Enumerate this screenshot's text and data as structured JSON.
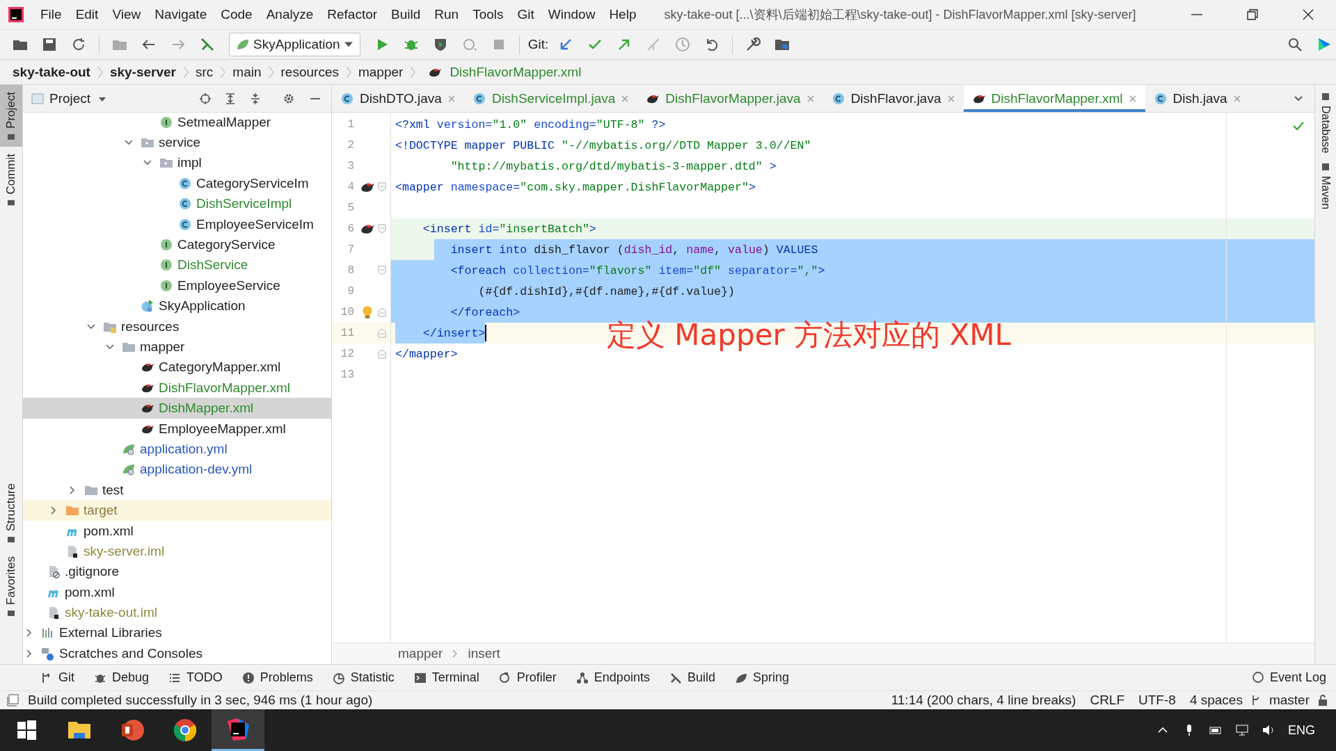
{
  "window": {
    "title": "sky-take-out [...\\资料\\后端初始工程\\sky-take-out] - DishFlavorMapper.xml [sky-server]"
  },
  "menu": [
    "File",
    "Edit",
    "View",
    "Navigate",
    "Code",
    "Analyze",
    "Refactor",
    "Build",
    "Run",
    "Tools",
    "Git",
    "Window",
    "Help"
  ],
  "toolbar": {
    "run_config": "SkyApplication",
    "git_label": "Git:"
  },
  "nav_path": [
    {
      "label": "sky-take-out",
      "kind": "module"
    },
    {
      "label": "sky-server",
      "kind": "module"
    },
    {
      "label": "src",
      "kind": "folder"
    },
    {
      "label": "main",
      "kind": "folder"
    },
    {
      "label": "resources",
      "kind": "folder"
    },
    {
      "label": "mapper",
      "kind": "folder"
    },
    {
      "label": "DishFlavorMapper.xml",
      "kind": "file"
    }
  ],
  "left_stripe": [
    {
      "label": "Project",
      "selected": true
    },
    {
      "label": "Commit",
      "selected": false
    },
    {
      "label": "Structure",
      "selected": false
    },
    {
      "label": "Favorites",
      "selected": false
    }
  ],
  "right_stripe": [
    {
      "label": "Database"
    },
    {
      "label": "Maven"
    }
  ],
  "project_panel": {
    "title": "Project",
    "tree": [
      {
        "children": [
          {
            "children": [
              {
                "children": [
                  {
                    "children": [
                      {
                        "children": [
                          {
                            "children": [
                              {
                                "children": [
                                  {
                                    "label": "SetmealMapper",
                                    "kind": "interface",
                                    "color": "#1f1f1f",
                                    "selected": false
                                  }
                                ]
                              },
                              {
                                "label": "service",
                                "kind": "package",
                                "color": "#1f1f1f",
                                "selected": false,
                                "expanded": true,
                                "children": [
                                  {
                                    "label": "impl",
                                    "kind": "package",
                                    "color": "#1f1f1f",
                                    "selected": false,
                                    "expanded": true,
                                    "children": [
                                      {
                                        "label": "CategoryServiceIm",
                                        "kind": "class",
                                        "color": "#1f1f1f",
                                        "selected": false
                                      },
                                      {
                                        "label": "DishServiceImpl",
                                        "kind": "class",
                                        "color": "#2f8a2f",
                                        "selected": false
                                      },
                                      {
                                        "label": "EmployeeServiceIm",
                                        "kind": "class",
                                        "color": "#1f1f1f",
                                        "selected": false
                                      }
                                    ]
                                  },
                                  {
                                    "label": "CategoryService",
                                    "kind": "interface",
                                    "color": "#1f1f1f",
                                    "selected": false
                                  },
                                  {
                                    "label": "DishService",
                                    "kind": "interface",
                                    "color": "#2f8a2f",
                                    "selected": false
                                  },
                                  {
                                    "label": "EmployeeService",
                                    "kind": "interface",
                                    "color": "#1f1f1f",
                                    "selected": false
                                  }
                                ]
                              },
                              {
                                "label": "SkyApplication",
                                "kind": "app",
                                "color": "#1f1f1f",
                                "selected": false
                              }
                            ]
                          }
                        ]
                      },
                      {
                        "label": "resources",
                        "kind": "resources",
                        "color": "#1f1f1f",
                        "selected": false,
                        "expanded": true,
                        "children": [
                          {
                            "label": "mapper",
                            "kind": "folder",
                            "color": "#1f1f1f",
                            "selected": false,
                            "expanded": true,
                            "children": [
                              {
                                "label": "CategoryMapper.xml",
                                "kind": "mybatis",
                                "color": "#1f1f1f",
                                "selected": false
                              },
                              {
                                "label": "DishFlavorMapper.xml",
                                "kind": "mybatis",
                                "color": "#2f8a2f",
                                "selected": false
                              },
                              {
                                "label": "DishMapper.xml",
                                "kind": "mybatis",
                                "color": "#2f8a2f",
                                "selected": true
                              },
                              {
                                "label": "EmployeeMapper.xml",
                                "kind": "mybatis",
                                "color": "#1f1f1f",
                                "selected": false
                              }
                            ]
                          },
                          {
                            "label": "application.yml",
                            "kind": "yml",
                            "color": "#2a57b8",
                            "selected": false
                          },
                          {
                            "label": "application-dev.yml",
                            "kind": "yml",
                            "color": "#2a57b8",
                            "selected": false
                          }
                        ]
                      }
                    ]
                  },
                  {
                    "label": "test",
                    "kind": "folder",
                    "color": "#1f1f1f",
                    "selected": false,
                    "expanded": false
                  }
                ]
              },
              {
                "label": "target",
                "kind": "excluded",
                "color": "#8c7a3c",
                "selected": false,
                "excluded": true,
                "expanded": false
              },
              {
                "label": "pom.xml",
                "kind": "maven",
                "color": "#1f1f1f",
                "selected": false
              },
              {
                "label": "sky-server.iml",
                "kind": "iml",
                "color": "#8c8a3c",
                "selected": false
              }
            ]
          },
          {
            "label": ".gitignore",
            "kind": "gitignore",
            "color": "#1f1f1f",
            "selected": false
          },
          {
            "label": "pom.xml",
            "kind": "maven",
            "color": "#1f1f1f",
            "selected": false
          },
          {
            "label": "sky-take-out.iml",
            "kind": "iml",
            "color": "#8c8a3c",
            "selected": false
          }
        ]
      },
      {
        "label": "External Libraries",
        "kind": "libraries",
        "color": "#1f1f1f",
        "selected": false,
        "expanded": false
      },
      {
        "label": "Scratches and Consoles",
        "kind": "scratches",
        "color": "#1f1f1f",
        "selected": false,
        "expanded": false
      }
    ]
  },
  "editor": {
    "tabs": [
      {
        "label": "DishDTO.java",
        "kind": "class",
        "color": "#1f1f1f",
        "selected": false
      },
      {
        "label": "DishServiceImpl.java",
        "kind": "class",
        "color": "#2f8a2f",
        "selected": false
      },
      {
        "label": "DishFlavorMapper.java",
        "kind": "mybatis",
        "color": "#2f8a2f",
        "selected": false
      },
      {
        "label": "DishFlavor.java",
        "kind": "class",
        "color": "#1f1f1f",
        "selected": false
      },
      {
        "label": "DishFlavorMapper.xml",
        "kind": "mybatis",
        "color": "#2f8a2f",
        "selected": true
      },
      {
        "label": "Dish.java",
        "kind": "class",
        "color": "#1f1f1f",
        "selected": false
      }
    ],
    "lines": [
      {
        "number": "1",
        "tokens": [
          {
            "text": "<?xml ",
            "kind": "tag"
          },
          {
            "text": "version=",
            "kind": "attr"
          },
          {
            "text": "\"1.0\"",
            "kind": "str"
          },
          {
            "text": " encoding=",
            "kind": "attr"
          },
          {
            "text": "\"UTF-8\"",
            "kind": "str"
          },
          {
            "text": " ?>",
            "kind": "tag"
          }
        ],
        "selected": false,
        "caret": false,
        "injected": false
      },
      {
        "number": "2",
        "tokens": [
          {
            "text": "<!DOCTYPE mapper PUBLIC ",
            "kind": "tag"
          },
          {
            "text": "\"-//mybatis.org//DTD Mapper 3.0//EN\"",
            "kind": "str"
          }
        ],
        "selected": false,
        "caret": false,
        "injected": false
      },
      {
        "number": "3",
        "tokens": [
          {
            "text": "        \"http://mybatis.org/dtd/mybatis-3-mapper.dtd\"",
            "kind": "str"
          },
          {
            "text": " >",
            "kind": "tag"
          }
        ],
        "selected": false,
        "caret": false,
        "injected": false
      },
      {
        "number": "4",
        "gutter": [
          {
            "kind": "mybatis"
          },
          {
            "kind": "fold_start"
          }
        ],
        "tokens": [
          {
            "text": "<mapper",
            "kind": "tag"
          },
          {
            "text": " namespace=",
            "kind": "attr"
          },
          {
            "text": "\"com.sky.mapper.DishFlavorMapper\"",
            "kind": "str"
          },
          {
            "text": ">",
            "kind": "tag"
          }
        ],
        "selected": false,
        "caret": false,
        "injected": false
      },
      {
        "number": "5",
        "selected": false,
        "caret": false,
        "injected": false
      },
      {
        "number": "6",
        "gutter": [
          {
            "kind": "mybatis"
          },
          {
            "kind": "fold_start"
          }
        ],
        "tokens": [
          {
            "text": "    <insert",
            "kind": "tag"
          },
          {
            "text": " id=",
            "kind": "attr"
          },
          {
            "text": "\"insertBatch\"",
            "kind": "str"
          },
          {
            "text": ">",
            "kind": "tag"
          }
        ],
        "selected": false,
        "caret": false,
        "injected": true
      },
      {
        "number": "7",
        "tokens": [
          {
            "text": "        insert into",
            "kind": "kw"
          },
          {
            "text": " dish_flavor (",
            "kind": "plain"
          },
          {
            "text": "dish_id",
            "kind": "col"
          },
          {
            "text": ", ",
            "kind": "plain"
          },
          {
            "text": "name",
            "kind": "col"
          },
          {
            "text": ", ",
            "kind": "plain"
          },
          {
            "text": "value",
            "kind": "col"
          },
          {
            "text": ") ",
            "kind": "plain"
          },
          {
            "text": "VALUES",
            "kind": "kw"
          }
        ],
        "selected": true,
        "caret": false,
        "injected": true
      },
      {
        "number": "8",
        "gutter": [
          {
            "kind": "fold_start"
          }
        ],
        "tokens": [
          {
            "text": "        <foreach",
            "kind": "tag"
          },
          {
            "text": " collection=",
            "kind": "attr"
          },
          {
            "text": "\"flavors\"",
            "kind": "str"
          },
          {
            "text": " item=",
            "kind": "attr"
          },
          {
            "text": "\"df\"",
            "kind": "str"
          },
          {
            "text": " separator=",
            "kind": "attr"
          },
          {
            "text": "\",\"",
            "kind": "str"
          },
          {
            "text": ">",
            "kind": "tag"
          }
        ],
        "selected": true,
        "caret": false,
        "injected": false
      },
      {
        "number": "9",
        "tokens": [
          {
            "text": "            (#{df.dishId},#{df.name},#{df.value})",
            "kind": "plain"
          }
        ],
        "selected": true,
        "caret": false,
        "injected": false
      },
      {
        "number": "10",
        "gutter": [
          {
            "kind": "bulb"
          },
          {
            "kind": "fold_end"
          }
        ],
        "tokens": [
          {
            "text": "        </foreach>",
            "kind": "tag"
          }
        ],
        "selected": true,
        "caret": false,
        "injected": false
      },
      {
        "number": "11",
        "gutter": [
          {
            "kind": "fold_end"
          }
        ],
        "tokens": [
          {
            "text": "    </insert>",
            "kind": "tag"
          }
        ],
        "selected": true,
        "caret": true,
        "injected": false
      },
      {
        "number": "12",
        "gutter": [
          {
            "kind": "fold_end"
          }
        ],
        "tokens": [
          {
            "text": "</mapper>",
            "kind": "tag"
          }
        ],
        "selected": false,
        "caret": false,
        "injected": false
      },
      {
        "number": "13",
        "selected": false,
        "caret": false,
        "injected": false
      }
    ],
    "annotation": "定义 Mapper 方法对应的 XML",
    "breadcrumb": [
      "mapper",
      "insert"
    ]
  },
  "tool_windows": [
    {
      "label": "Git",
      "kind": "git"
    },
    {
      "label": "Debug",
      "kind": "debug"
    },
    {
      "label": "TODO",
      "kind": "todo"
    },
    {
      "label": "Problems",
      "kind": "problems"
    },
    {
      "label": "Statistic",
      "kind": "statistic"
    },
    {
      "label": "Terminal",
      "kind": "terminal"
    },
    {
      "label": "Profiler",
      "kind": "profiler"
    },
    {
      "label": "Endpoints",
      "kind": "endpoints"
    },
    {
      "label": "Build",
      "kind": "build"
    },
    {
      "label": "Spring",
      "kind": "spring"
    }
  ],
  "event_log": "Event Log",
  "status_bar": {
    "message": "Build completed successfully in 3 sec, 946 ms (1 hour ago)",
    "position": "11:14 (200 chars, 4 line breaks)",
    "line_separator": "CRLF",
    "encoding": "UTF-8",
    "indent": "4 spaces",
    "branch": "master"
  },
  "taskbar": {
    "apps": [
      {
        "kind": "explorer",
        "selected": false
      },
      {
        "kind": "powerpoint",
        "selected": false
      },
      {
        "kind": "chrome",
        "selected": false
      },
      {
        "kind": "intellij",
        "selected": true
      }
    ],
    "language": "ENG"
  }
}
